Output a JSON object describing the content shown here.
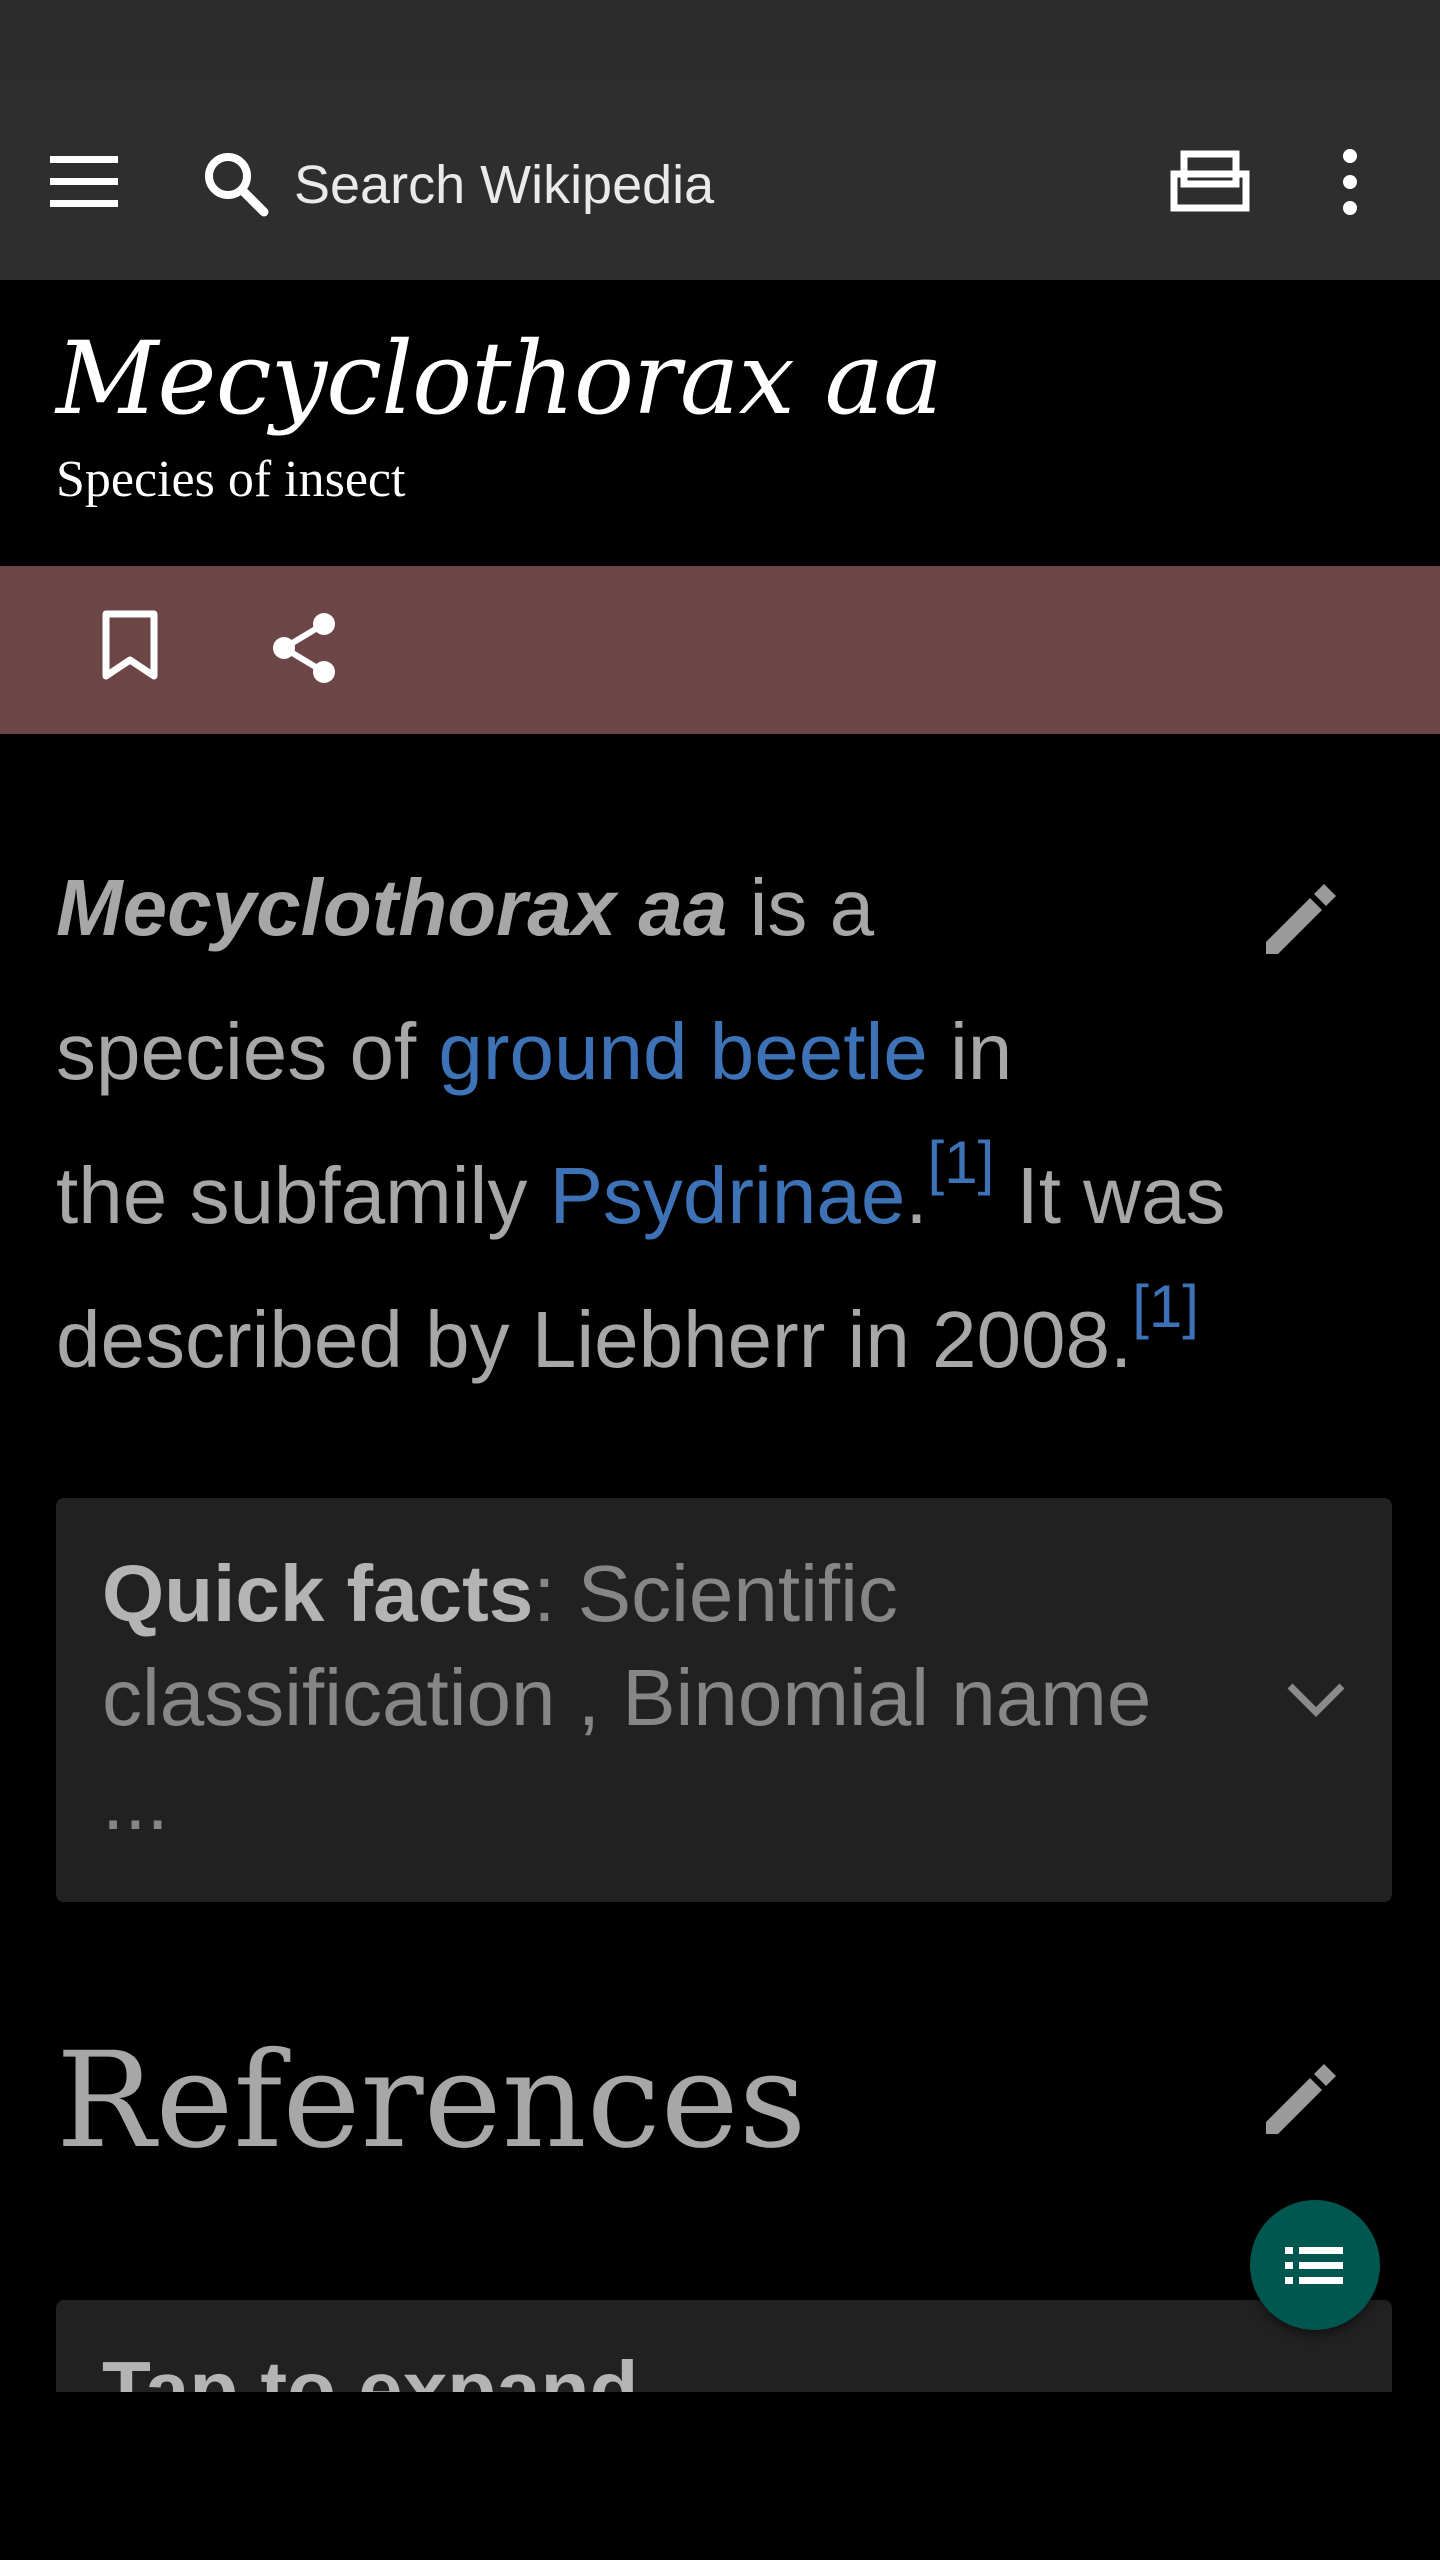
{
  "toolbar": {
    "search_placeholder": "Search Wikipedia",
    "menu_icon": "hamburger-menu-icon",
    "search_icon": "search-icon",
    "tabs_icon": "tabs-icon",
    "more_icon": "more-vert-icon"
  },
  "article": {
    "title": "Mecyclothorax aa",
    "description": "Species of insect"
  },
  "actions": {
    "bookmark_icon": "bookmark-icon",
    "share_icon": "share-icon",
    "bar_color": "#6c4546"
  },
  "intro": {
    "bold_title": "Mecyclothorax aa",
    "text_1": " is a",
    "text_2": "species of ",
    "link_ground_beetle": "ground beetle",
    "text_3": " in",
    "text_4": "the subfamily ",
    "link_psydrinae": "Psydrinae",
    "text_5": ".",
    "ref_1": "[1]",
    "text_6": " It was",
    "text_7": "described by Liebherr in 2008.",
    "ref_2": "[1]"
  },
  "quick_facts": {
    "label": "Quick facts",
    "text": ": Scientific classification , Binomial name ..."
  },
  "references": {
    "heading": "References",
    "collapsed_text": "Tap to expand"
  },
  "colors": {
    "link": "#3d73b6",
    "fab": "#00574f"
  }
}
